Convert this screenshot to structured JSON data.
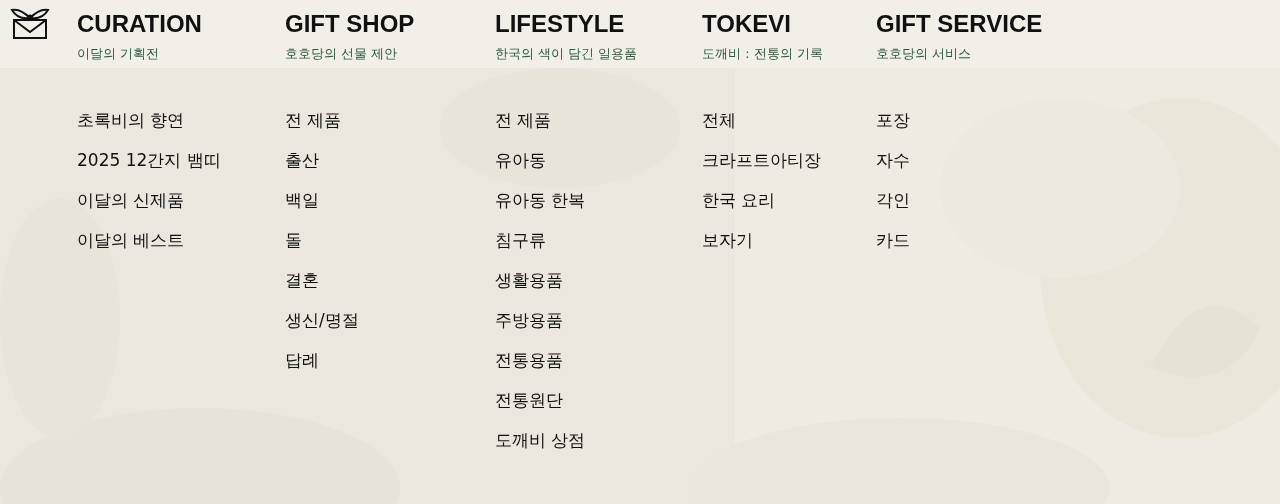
{
  "columns": [
    {
      "title": "CURATION",
      "subtitle": "이달의 기획전",
      "items": [
        "초록비의 향연",
        "2025 12간지 뱀띠",
        "이달의 신제품",
        "이달의 베스트"
      ]
    },
    {
      "title": "GIFT SHOP",
      "subtitle": "호호당의 선물 제안",
      "items": [
        "전 제품",
        "출산",
        "백일",
        "돌",
        "결혼",
        "생신/명절",
        "답례"
      ]
    },
    {
      "title": "LIFESTYLE",
      "subtitle": "한국의 색이 담긴 일용품",
      "items": [
        "전 제품",
        "유아동",
        "유아동 한복",
        "침구류",
        "생활용품",
        "주방용품",
        "전통용품",
        "전통원단",
        "도깨비 상점"
      ]
    },
    {
      "title": "TOKEVI",
      "subtitle": "도깨비 : 전통의 기록",
      "items": [
        "전체",
        "크라프트아티장",
        "한국 요리",
        "보자기"
      ]
    },
    {
      "title": "GIFT SERVICE",
      "subtitle": "호호당의 서비스",
      "items": [
        "포장",
        "자수",
        "각인",
        "카드"
      ]
    }
  ]
}
